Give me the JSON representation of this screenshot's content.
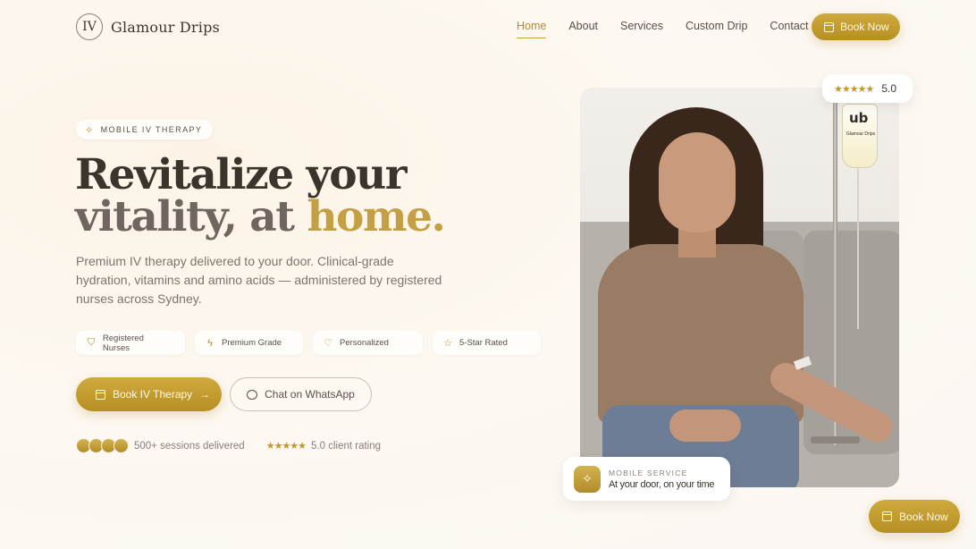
{
  "brand": {
    "mark": "IV",
    "name": "Glamour Drips"
  },
  "nav": {
    "items": [
      {
        "label": "Home",
        "active": true
      },
      {
        "label": "About"
      },
      {
        "label": "Services"
      },
      {
        "label": "Custom Drip"
      },
      {
        "label": "Contact"
      }
    ],
    "book_label": "Book Now"
  },
  "hero": {
    "pill": "MOBILE IV THERAPY",
    "headline_line1": "Revitalize your",
    "headline_line2_a": "vitality,",
    "headline_line2_b": "at",
    "headline_line2_c": "home.",
    "lead": "Premium IV therapy delivered to your door. Clinical-grade hydration, vitamins and amino acids — administered by registered nurses across Sydney.",
    "features": [
      {
        "label": "Registered Nurses",
        "icon": "shield-icon"
      },
      {
        "label": "Premium Grade",
        "icon": "lightning-icon"
      },
      {
        "label": "Personalized",
        "icon": "heart-icon"
      },
      {
        "label": "5-Star Rated",
        "icon": "star-icon"
      }
    ],
    "cta_primary": "Book IV Therapy",
    "cta_secondary": "Chat on WhatsApp",
    "sessions": "500+ sessions delivered",
    "client_rating": "5.0 client rating",
    "stars": "★★★★★"
  },
  "rating_card": {
    "stars": "★★★★★",
    "score": "5.0"
  },
  "iv_bag": {
    "logo": "ub",
    "label": "Glamour Drips"
  },
  "mobile_card": {
    "kicker": "MOBILE SERVICE",
    "title": "At your door, on your time"
  },
  "floating_book": "Book Now",
  "colors": {
    "accent": "#c4a044",
    "accent_dark": "#b08d2a",
    "text": "#3b342d",
    "background": "#fbf6ee"
  }
}
